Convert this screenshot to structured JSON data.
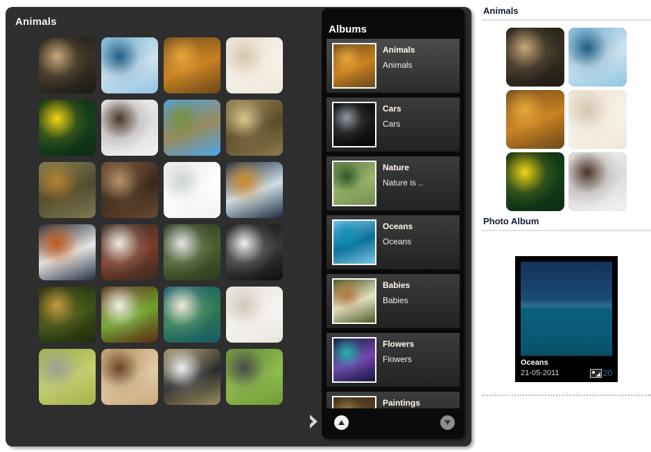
{
  "gallery": {
    "title": "Animals",
    "next_label": "›",
    "next_icon": "chevron-right-icon",
    "photos": [
      {
        "name": "leopard",
        "c1": "#1b1a14",
        "c2": "#c8a97a",
        "c3": "#3a3124"
      },
      {
        "name": "dolphins",
        "c1": "#8fc4e2",
        "c2": "#1d5d86",
        "c3": "#cfe4ef"
      },
      {
        "name": "giraffes",
        "c1": "#6b4a1c",
        "c2": "#e8a63a",
        "c3": "#c87f1f"
      },
      {
        "name": "white-snake",
        "c1": "#efe7db",
        "c2": "#d6c6ae",
        "c3": "#f7f2e9"
      },
      {
        "name": "yellow-tang-fish",
        "c1": "#0c2b11",
        "c2": "#f3d516",
        "c3": "#15401b"
      },
      {
        "name": "running-horses",
        "c1": "#f2f2f2",
        "c2": "#4b3327",
        "c3": "#dcdcdc"
      },
      {
        "name": "kangaroos",
        "c1": "#4da3e8",
        "c2": "#7a8f3e",
        "c3": "#9b8b5f"
      },
      {
        "name": "leopard-tree",
        "c1": "#8b7b4e",
        "c2": "#d9c58e",
        "c3": "#5a4a2a"
      },
      {
        "name": "lion",
        "c1": "#7f7a52",
        "c2": "#b3812e",
        "c3": "#4f4a2e"
      },
      {
        "name": "meerkat",
        "c1": "#6a4b33",
        "c2": "#b79468",
        "c3": "#3a281a"
      },
      {
        "name": "arctic-fox",
        "c1": "#f0f0f0",
        "c2": "#cfd3d6",
        "c3": "#ffffff"
      },
      {
        "name": "tiger-snow",
        "c1": "#1d2d3f",
        "c2": "#d08a2e",
        "c3": "#cfe0ec"
      },
      {
        "name": "tiger-face",
        "c1": "#243043",
        "c2": "#c25a1c",
        "c3": "#e8e8e8"
      },
      {
        "name": "white-lion",
        "c1": "#3a2a20",
        "c2": "#f2ece2",
        "c3": "#7a3b2c"
      },
      {
        "name": "white-tigers",
        "c1": "#2a3a1c",
        "c2": "#e6e6e6",
        "c3": "#4c6030"
      },
      {
        "name": "white-horse",
        "c1": "#0e0e0e",
        "c2": "#f0f0f0",
        "c3": "#3a3a3a"
      },
      {
        "name": "cheetah-running",
        "c1": "#1e2a0c",
        "c2": "#c79a40",
        "c3": "#3f5418"
      },
      {
        "name": "cows",
        "c1": "#5d2c18",
        "c2": "#f3efe6",
        "c3": "#6ea32c"
      },
      {
        "name": "puppy",
        "c1": "#17596a",
        "c2": "#f3ead6",
        "c3": "#2f7d52"
      },
      {
        "name": "polar-bears",
        "c1": "#e9e4de",
        "c2": "#d2c9bd",
        "c3": "#f7f5f2"
      },
      {
        "name": "kittens",
        "c1": "#a3b24a",
        "c2": "#9e9e96",
        "c3": "#c5cf6e"
      },
      {
        "name": "camel",
        "c1": "#c9a97c",
        "c2": "#6b4526",
        "c3": "#e2cba4"
      },
      {
        "name": "zebras",
        "c1": "#9b8d5e",
        "c2": "#f0f0f0",
        "c3": "#2a2a2a"
      },
      {
        "name": "elephant",
        "c1": "#6f9a3a",
        "c2": "#4a4a4a",
        "c3": "#8fbe4e"
      }
    ]
  },
  "albums": {
    "title": "Albums",
    "scroll_up_icon": "triangle-up-icon",
    "scroll_down_icon": "triangle-down-icon",
    "items": [
      {
        "name": "Animals",
        "desc": "Animals",
        "selected": true,
        "thumb": "giraffes",
        "c1": "#6b4a1c",
        "c2": "#e8a63a",
        "c3": "#c87f1f"
      },
      {
        "name": "Cars",
        "desc": "Cars",
        "selected": false,
        "thumb": "black-car",
        "c1": "#050505",
        "c2": "#8f9aa3",
        "c3": "#1a1a1a"
      },
      {
        "name": "Nature",
        "desc": "Nature is ..",
        "selected": false,
        "thumb": "green-hills",
        "c1": "#6f8a4e",
        "c2": "#2f5a2a",
        "c3": "#9db76e"
      },
      {
        "name": "Oceans",
        "desc": "Oceans",
        "selected": false,
        "thumb": "ocean",
        "c1": "#7ec4e8",
        "c2": "#0e8fb8",
        "c3": "#0a6f94"
      },
      {
        "name": "Babies",
        "desc": "Babies",
        "selected": false,
        "thumb": "baby-flowers",
        "c1": "#4a5a22",
        "c2": "#b3763c",
        "c3": "#e8e4c8"
      },
      {
        "name": "Flowers",
        "desc": "Flowers",
        "selected": false,
        "thumb": "night-flower",
        "c1": "#0d1b3a",
        "c2": "#27b6a8",
        "c3": "#7a3fb0"
      },
      {
        "name": "Paintings",
        "desc": "",
        "selected": false,
        "thumb": "painting",
        "c1": "#3a2a14",
        "c2": "#9b7a44",
        "c3": "#5a4226"
      }
    ]
  },
  "sidebar": {
    "animals_heading": "Animals",
    "photo_album_heading": "Photo Album",
    "thumbs": [
      {
        "name": "leopard",
        "c1": "#1b1a14",
        "c2": "#c8a97a",
        "c3": "#3a3124"
      },
      {
        "name": "dolphins",
        "c1": "#8fc4e2",
        "c2": "#1d5d86",
        "c3": "#cfe4ef"
      },
      {
        "name": "giraffes",
        "c1": "#6b4a1c",
        "c2": "#e8a63a",
        "c3": "#c87f1f"
      },
      {
        "name": "white-snake",
        "c1": "#efe7db",
        "c2": "#d6c6ae",
        "c3": "#f7f2e9"
      },
      {
        "name": "yellow-tang-fish",
        "c1": "#0c2b11",
        "c2": "#f3d516",
        "c3": "#15401b"
      },
      {
        "name": "running-horses",
        "c1": "#f2f2f2",
        "c2": "#4b3327",
        "c3": "#dcdcdc"
      }
    ],
    "album_card": {
      "title": "Oceans",
      "date": "21-05-2011",
      "photo_count": "20",
      "count_icon": "picture-icon",
      "image_name": "ocean-horizon"
    }
  },
  "colors": {
    "page_bg": "#ffffff",
    "gallery_bg": "#2e2e2e",
    "albums_bg": "#0a0a0a",
    "heading_text": "#151b33",
    "rule": "#e6dcdc",
    "count_blue": "#3b6fb5"
  }
}
